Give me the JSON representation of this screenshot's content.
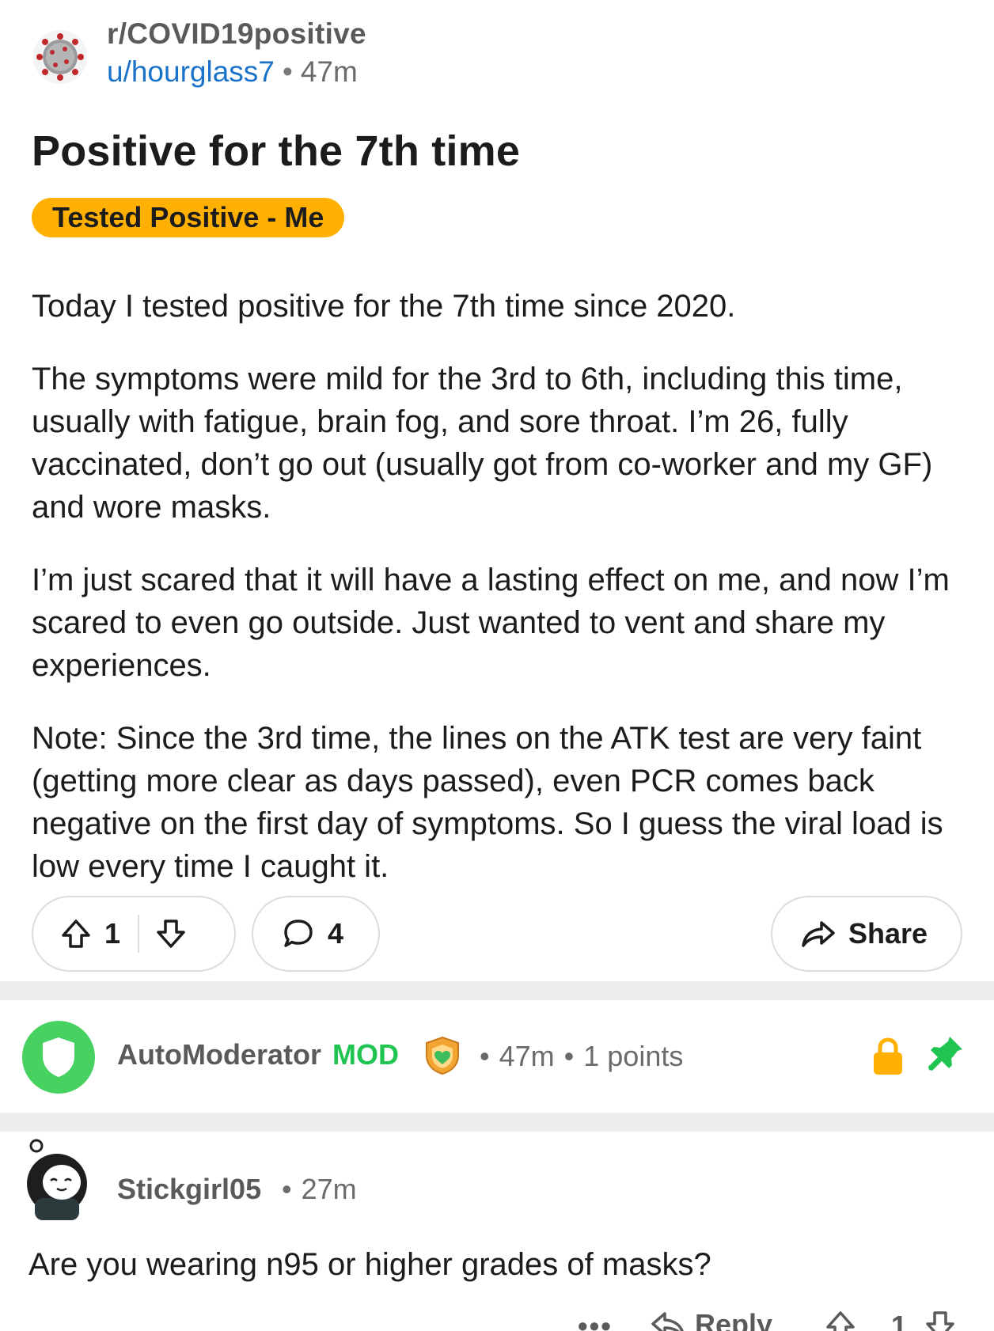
{
  "post": {
    "subreddit": "r/COVID19positive",
    "author": "u/hourglass7",
    "age": "47m",
    "title": "Positive for the 7th time",
    "flair": "Tested Positive - Me",
    "paragraphs": [
      "Today I tested positive for the 7th time since 2020.",
      "The symptoms were mild for the 3rd to 6th, including this time, usually with fatigue, brain fog, and sore throat. I’m 26, fully vaccinated, don’t go out (usually got from co-worker and my GF) and wore masks.",
      "I’m just scared that it will have a lasting effect on me, and now I’m scared to even go outside. Just wanted to vent and share my experiences.",
      "Note: Since the 3rd time, the lines on the ATK test are very faint (getting more clear as days passed), even PCR comes back negative on the first day of symptoms. So I guess the viral load is low every time I caught it."
    ],
    "vote_count": "1",
    "comment_count": "4",
    "share_label": "Share"
  },
  "automod": {
    "name": "AutoModerator",
    "mod_label": "MOD",
    "age": "47m",
    "points": "1 points"
  },
  "comment": {
    "author": "Stickgirl05",
    "age": "27m",
    "text": "Are you wearing n95 or higher grades of masks?",
    "more": "•••",
    "reply_label": "Reply",
    "score": "1"
  },
  "colors": {
    "link_blue": "#1a73c8",
    "flair_bg": "#ffb000",
    "mod_green": "#46d160",
    "lock_orange": "#ffb000"
  }
}
